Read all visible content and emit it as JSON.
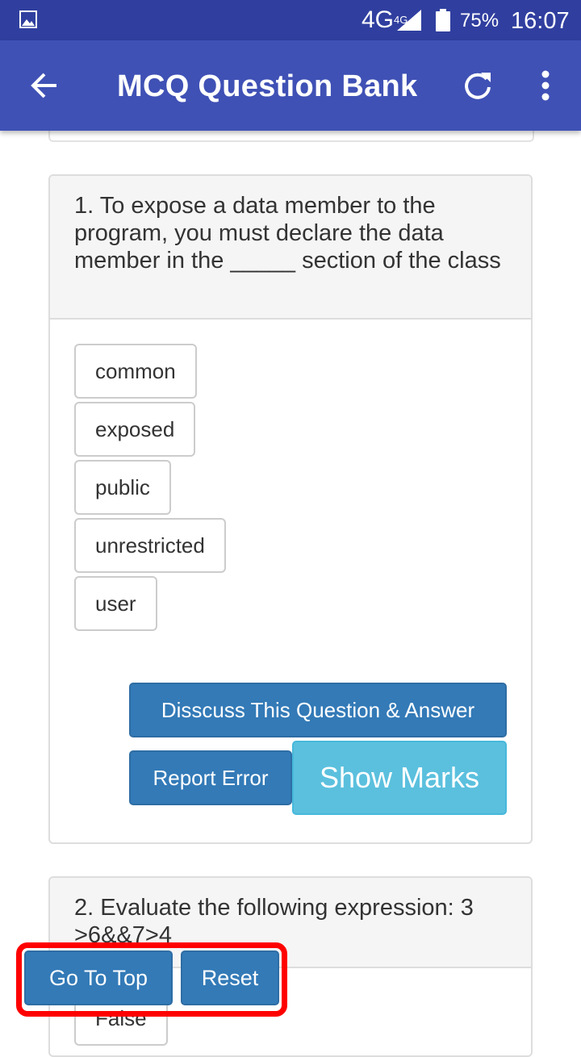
{
  "status_bar": {
    "network": "4G",
    "network_sup": "4G",
    "battery": "75%",
    "time": "16:07",
    "icons": [
      "gallery-icon",
      "signal-icon",
      "battery-icon"
    ]
  },
  "app_bar": {
    "title": "MCQ Question Bank",
    "icons": [
      "back-arrow-icon",
      "refresh-icon",
      "more-vert-icon"
    ],
    "color": "#3f51b5"
  },
  "questions": [
    {
      "text": "1. To expose a data member to the program, you must declare the data member in the _____ section of the class",
      "options": [
        "common",
        "exposed",
        "public",
        "unrestricted",
        "user"
      ],
      "discuss_label": "Disscuss This Question & Answer",
      "report_label": "Report Error",
      "marks_label": "Show Marks"
    },
    {
      "text": "2. Evaluate the following expression: 3 >6&&7>4",
      "options": [
        "False"
      ]
    }
  ],
  "floating": {
    "top_label": "Go To Top",
    "reset_label": "Reset",
    "highlight_color": "#ff0000"
  },
  "colors": {
    "primary_button": "#337ab7",
    "info_button": "#5bc0de",
    "status_bar": "#303f9f"
  }
}
